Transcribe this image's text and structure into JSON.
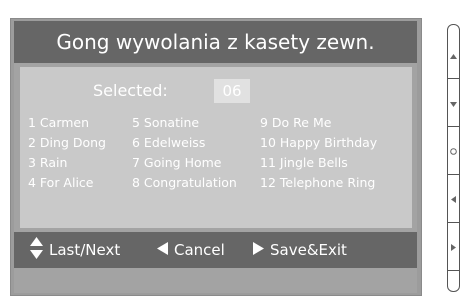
{
  "header": {
    "title": "Gong wywolania z kasety zewn."
  },
  "selection": {
    "label": "Selected:",
    "value": "06"
  },
  "gongs": {
    "col1": [
      "1 Carmen",
      "2 Ding Dong",
      "3 Rain",
      "4 For Alice"
    ],
    "col2": [
      "5 Sonatine",
      "6 Edelweiss",
      "7 Going Home",
      "8 Congratulation"
    ],
    "col3": [
      "9 Do Re Me",
      "10 Happy Birthday",
      "11 Jingle Bells",
      "12 Telephone Ring"
    ]
  },
  "footer": {
    "last_next": "Last/Next",
    "cancel": "Cancel",
    "save_exit": "Save&Exit"
  },
  "side_buttons": [
    "up-icon",
    "down-icon",
    "circle-icon",
    "left-icon",
    "right-icon"
  ]
}
